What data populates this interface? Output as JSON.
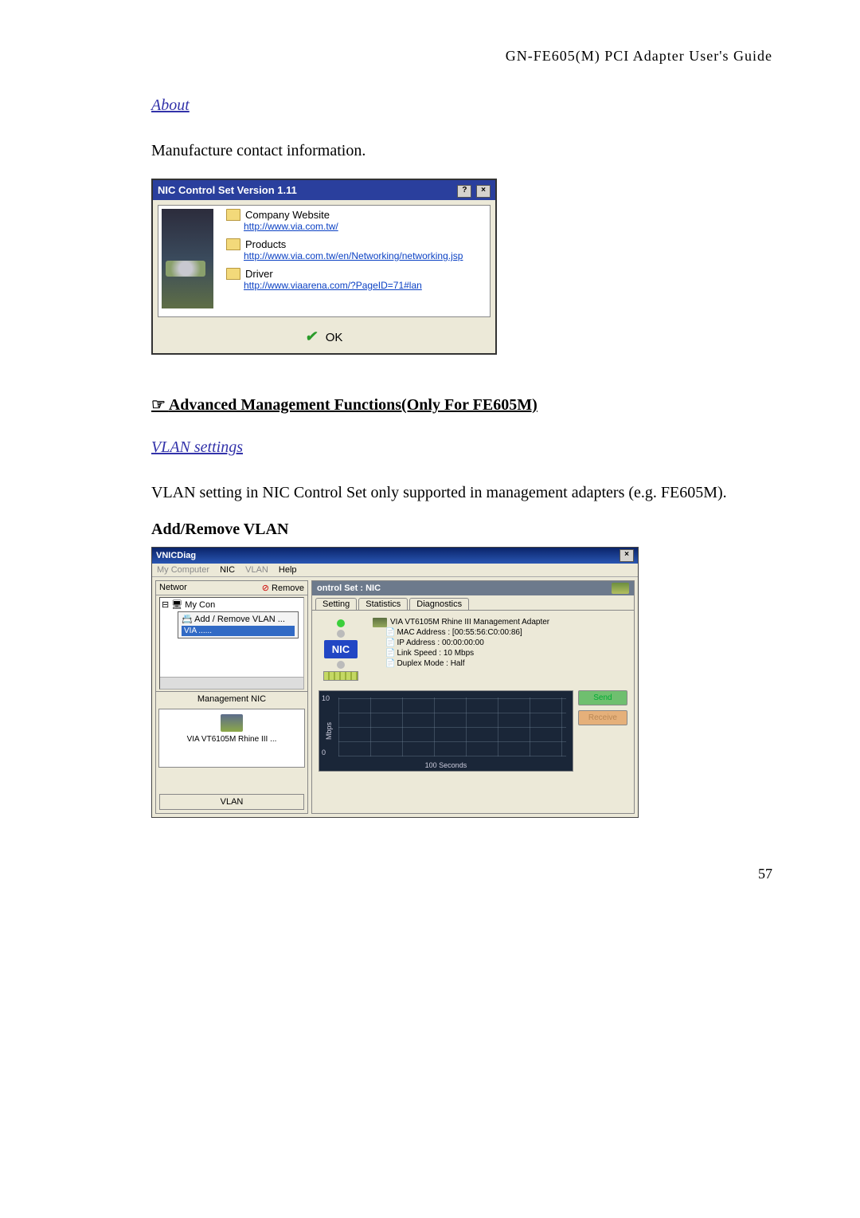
{
  "header": "GN-FE605(M)  PCI  Adapter  User's  Guide",
  "about": {
    "heading": "About",
    "desc": "Manufacture contact information.",
    "title": "NIC Control Set  Version 1.11",
    "help_btn": "?",
    "close_btn": "×",
    "items": [
      {
        "label": "Company Website",
        "url": "http://www.via.com.tw/"
      },
      {
        "label": "Products",
        "url": "http://www.via.com.tw/en/Networking/networking.jsp"
      },
      {
        "label": "Driver",
        "url": "http://www.viaarena.com/?PageID=71#lan"
      }
    ],
    "ok": "OK"
  },
  "advanced": {
    "title": "Advanced Management Functions(Only For FE605M)",
    "vlan_heading": "VLAN settings",
    "vlan_desc": "VLAN setting in NIC Control Set only supported in management adapters (e.g. FE605M).",
    "addremove": "Add/Remove VLAN"
  },
  "vnic": {
    "title": "VNICDiag",
    "close_btn": "×",
    "menu": {
      "my_computer": "My Computer",
      "nic": "NIC",
      "vlan": "VLAN",
      "help": "Help"
    },
    "left": {
      "network_label": "Networ",
      "remove": "Remove",
      "tree_root": "My Con",
      "ctx_add": "Add / Remove VLAN ...",
      "ctx_highlight": "VIA ......",
      "mgmt_label": "Management NIC",
      "mgmt_caption": "VIA VT6105M Rhine III ...",
      "vlan_btn": "VLAN"
    },
    "right": {
      "header": "ontrol Set : NIC",
      "tabs": [
        "Setting",
        "Statistics",
        "Diagnostics"
      ],
      "adapter": "VIA VT6105M Rhine III Management Adapter",
      "details": [
        "MAC Address : [00:55:56:C0:00:86]",
        "IP Address : 00:00:00:00",
        "Link Speed : 10 Mbps",
        "Duplex Mode : Half"
      ],
      "nic_logo": "NIC",
      "legend": {
        "send": "Send",
        "receive": "Receive"
      }
    }
  },
  "chart_data": {
    "type": "line",
    "title": "",
    "xlabel": "100 Seconds",
    "ylabel": "Mbps",
    "ylim": [
      0,
      10
    ],
    "x_range_seconds": 100,
    "series": [
      {
        "name": "Send",
        "values": []
      },
      {
        "name": "Receive",
        "values": []
      }
    ]
  },
  "page_number": "57"
}
